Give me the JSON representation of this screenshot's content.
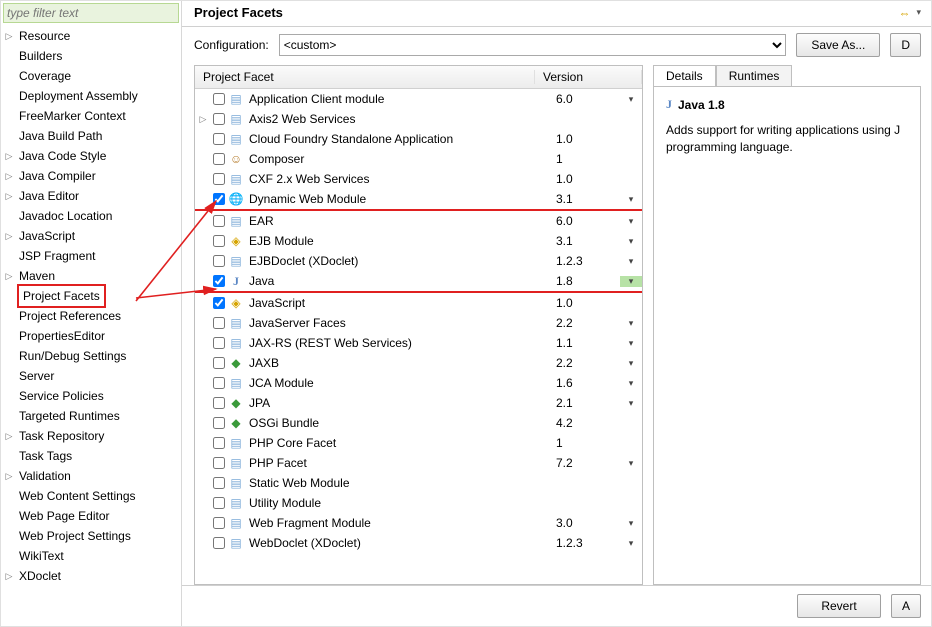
{
  "filter_placeholder": "type filter text",
  "sidebar": {
    "items": [
      {
        "label": "Resource",
        "exp": true
      },
      {
        "label": "Builders",
        "exp": false
      },
      {
        "label": "Coverage",
        "exp": false
      },
      {
        "label": "Deployment Assembly",
        "exp": false
      },
      {
        "label": "FreeMarker Context",
        "exp": false
      },
      {
        "label": "Java Build Path",
        "exp": false
      },
      {
        "label": "Java Code Style",
        "exp": true
      },
      {
        "label": "Java Compiler",
        "exp": true
      },
      {
        "label": "Java Editor",
        "exp": true
      },
      {
        "label": "Javadoc Location",
        "exp": false
      },
      {
        "label": "JavaScript",
        "exp": true
      },
      {
        "label": "JSP Fragment",
        "exp": false
      },
      {
        "label": "Maven",
        "exp": true
      },
      {
        "label": "Project Facets",
        "exp": false,
        "selected": true
      },
      {
        "label": "Project References",
        "exp": false
      },
      {
        "label": "PropertiesEditor",
        "exp": false
      },
      {
        "label": "Run/Debug Settings",
        "exp": false
      },
      {
        "label": "Server",
        "exp": false
      },
      {
        "label": "Service Policies",
        "exp": false
      },
      {
        "label": "Targeted Runtimes",
        "exp": false
      },
      {
        "label": "Task Repository",
        "exp": true
      },
      {
        "label": "Task Tags",
        "exp": false
      },
      {
        "label": "Validation",
        "exp": true
      },
      {
        "label": "Web Content Settings",
        "exp": false
      },
      {
        "label": "Web Page Editor",
        "exp": false
      },
      {
        "label": "Web Project Settings",
        "exp": false
      },
      {
        "label": "WikiText",
        "exp": false
      },
      {
        "label": "XDoclet",
        "exp": true
      }
    ]
  },
  "title": "Project Facets",
  "config_label": "Configuration:",
  "config_value": "<custom>",
  "save_as_label": "Save As...",
  "delete_label": "D",
  "headers": {
    "facet": "Project Facet",
    "version": "Version"
  },
  "facets": [
    {
      "name": "Application Client module",
      "ver": "6.0",
      "dd": true,
      "chk": false,
      "icon": "doc"
    },
    {
      "name": "Axis2 Web Services",
      "ver": "",
      "dd": false,
      "chk": false,
      "icon": "doc",
      "exp": true
    },
    {
      "name": "Cloud Foundry Standalone Application",
      "ver": "1.0",
      "dd": false,
      "chk": false,
      "icon": "doc"
    },
    {
      "name": "Composer",
      "ver": "1",
      "dd": false,
      "chk": false,
      "icon": "comp"
    },
    {
      "name": "CXF 2.x Web Services",
      "ver": "1.0",
      "dd": false,
      "chk": false,
      "icon": "doc"
    },
    {
      "name": "Dynamic Web Module",
      "ver": "3.1",
      "dd": true,
      "chk": true,
      "icon": "globe",
      "hl": "red"
    },
    {
      "name": "EAR",
      "ver": "6.0",
      "dd": true,
      "chk": false,
      "icon": "doc"
    },
    {
      "name": "EJB Module",
      "ver": "3.1",
      "dd": true,
      "chk": false,
      "icon": "gold"
    },
    {
      "name": "EJBDoclet (XDoclet)",
      "ver": "1.2.3",
      "dd": true,
      "chk": false,
      "icon": "doc"
    },
    {
      "name": "Java",
      "ver": "1.8",
      "dd": true,
      "chk": true,
      "icon": "j",
      "hl": "red",
      "greenDd": true
    },
    {
      "name": "JavaScript",
      "ver": "1.0",
      "dd": false,
      "chk": true,
      "icon": "gold"
    },
    {
      "name": "JavaServer Faces",
      "ver": "2.2",
      "dd": true,
      "chk": false,
      "icon": "doc"
    },
    {
      "name": "JAX-RS (REST Web Services)",
      "ver": "1.1",
      "dd": true,
      "chk": false,
      "icon": "doc"
    },
    {
      "name": "JAXB",
      "ver": "2.2",
      "dd": true,
      "chk": false,
      "icon": "green"
    },
    {
      "name": "JCA Module",
      "ver": "1.6",
      "dd": true,
      "chk": false,
      "icon": "doc"
    },
    {
      "name": "JPA",
      "ver": "2.1",
      "dd": true,
      "chk": false,
      "icon": "green"
    },
    {
      "name": "OSGi Bundle",
      "ver": "4.2",
      "dd": false,
      "chk": false,
      "icon": "green"
    },
    {
      "name": "PHP Core Facet",
      "ver": "1",
      "dd": false,
      "chk": false,
      "icon": "doc"
    },
    {
      "name": "PHP Facet",
      "ver": "7.2",
      "dd": true,
      "chk": false,
      "icon": "doc"
    },
    {
      "name": "Static Web Module",
      "ver": "",
      "dd": false,
      "chk": false,
      "icon": "doc"
    },
    {
      "name": "Utility Module",
      "ver": "",
      "dd": false,
      "chk": false,
      "icon": "doc"
    },
    {
      "name": "Web Fragment Module",
      "ver": "3.0",
      "dd": true,
      "chk": false,
      "icon": "doc"
    },
    {
      "name": "WebDoclet (XDoclet)",
      "ver": "1.2.3",
      "dd": true,
      "chk": false,
      "icon": "doc"
    }
  ],
  "details": {
    "tabs": [
      "Details",
      "Runtimes"
    ],
    "heading": "Java 1.8",
    "text": "Adds support for writing applications using J programming language."
  },
  "bottom": {
    "revert": "Revert",
    "apply": "A"
  }
}
